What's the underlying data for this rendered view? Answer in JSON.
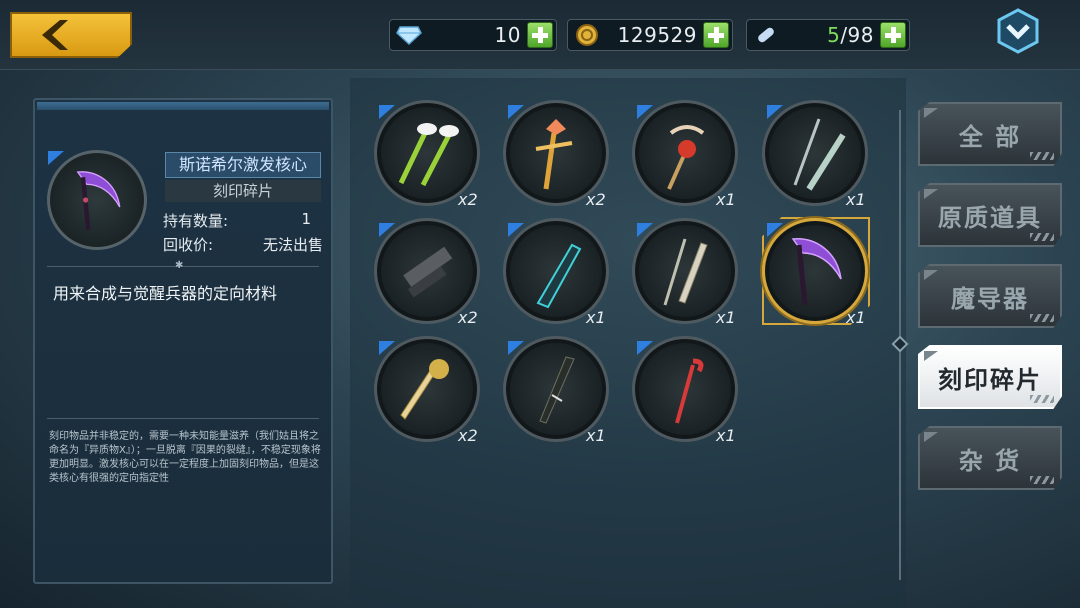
{
  "header": {
    "diamonds": "10",
    "gold": "129529",
    "capacity_used": "5",
    "capacity_max": "/98"
  },
  "detail": {
    "name": "斯诺希尔激发核心",
    "type": "刻印碎片",
    "owned_label": "持有数量:",
    "owned_value": "1",
    "recycle_label": "回收价:",
    "recycle_value": "无法出售",
    "description": "用来合成与觉醒兵器的定向材料",
    "lore": "刻印物品并非稳定的，需要一种未知能量滋养（我们姑且将之命名为『异质物X』）；一旦脱离『因果的裂缝』，不稳定现象将更加明显。激发核心可以在一定程度上加固刻印物品，但是这类核心有很强的定向指定性"
  },
  "items": [
    {
      "count": "x2",
      "icon": "feather-darts-icon"
    },
    {
      "count": "x2",
      "icon": "winged-staff-icon"
    },
    {
      "count": "x1",
      "icon": "rose-scepter-icon"
    },
    {
      "count": "x1",
      "icon": "twin-swords-icon"
    },
    {
      "count": "x2",
      "icon": "cannon-blade-icon"
    },
    {
      "count": "x1",
      "icon": "cyan-blade-icon"
    },
    {
      "count": "x1",
      "icon": "twin-spears-icon"
    },
    {
      "count": "x1",
      "icon": "purple-scythe-icon"
    },
    {
      "count": "x2",
      "icon": "golden-sword-icon"
    },
    {
      "count": "x1",
      "icon": "dark-katana-icon"
    },
    {
      "count": "x1",
      "icon": "red-cane-icon"
    }
  ],
  "categories": [
    "全 部",
    "原质道具",
    "魔导器",
    "刻印碎片",
    "杂 货"
  ],
  "active_category": "刻印碎片"
}
